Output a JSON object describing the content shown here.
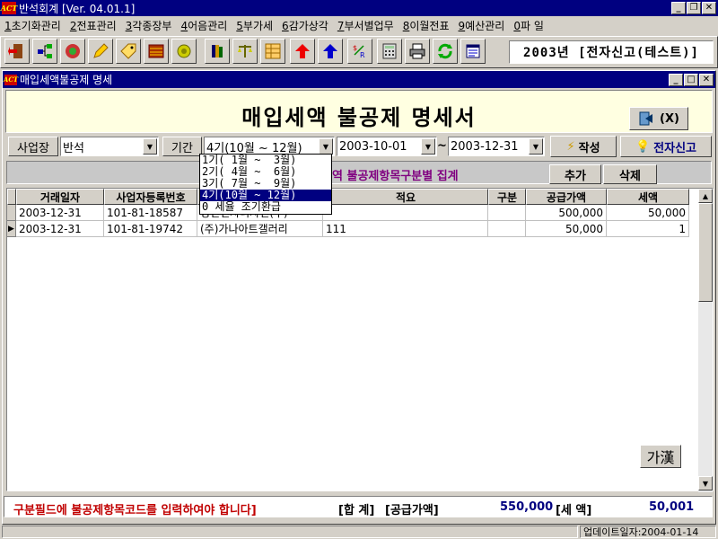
{
  "app": {
    "title": "반석회계 [Ver. 04.01.1]",
    "logo": "ACT"
  },
  "menu": [
    {
      "key": "1",
      "label": "초기화관리"
    },
    {
      "key": "2",
      "label": "전표관리"
    },
    {
      "key": "3",
      "label": "각종장부"
    },
    {
      "key": "4",
      "label": "어음관리"
    },
    {
      "key": "5",
      "label": "부가세"
    },
    {
      "key": "6",
      "label": "감가상각"
    },
    {
      "key": "7",
      "label": "부서별업무"
    },
    {
      "key": "8",
      "label": "이월전표"
    },
    {
      "key": "9",
      "label": "예산관리"
    },
    {
      "key": "0",
      "label": "파 일"
    }
  ],
  "toolbar": {
    "icons": [
      "exit-door-icon",
      "org-tree-icon",
      "globe-icon",
      "pencil-icon",
      "tag-icon",
      "abacus-icon",
      "coin-icon",
      "books-icon",
      "scale-icon",
      "grid-icon",
      "arrow-up-red-icon",
      "arrow-up-blue-icon",
      "currency-icon",
      "calculator-icon",
      "printer-icon",
      "refresh-icon",
      "document-icon"
    ],
    "company": "2003년 [전자신고(테스트)]"
  },
  "child": {
    "title": "매입세액불공제 명세",
    "heading": "매입세액 불공제 명세서",
    "exit_label": "(X)"
  },
  "filters": {
    "business_label": "사업장",
    "business_value": "반석",
    "period_label": "기간",
    "period_value": "4기(10월 ~ 12월)",
    "date_from": "2003-10-01",
    "date_to": "2003-12-31",
    "tilde": "~",
    "create_label": "작성",
    "efile_label": "전자신고"
  },
  "period_options": [
    "1기( 1월 ~  3월)",
    "2기( 4월 ~  6월)",
    "3기( 7월 ~  9월)",
    "4기(10월 ~ 12월)",
    "0 세율 조기환급"
  ],
  "section": {
    "label": "역 불공제항목구분별 집계",
    "add_label": "추가",
    "delete_label": "삭제"
  },
  "grid": {
    "columns": [
      "거래일자",
      "사업자등록번호",
      "",
      "적요",
      "구분",
      "공급가액",
      "세액"
    ],
    "rows": [
      {
        "date": "2003-12-31",
        "regno": "101-81-18587",
        "name": "명진전자디자인(주)",
        "memo": "",
        "type": "",
        "supply": "500,000",
        "tax": "50,000"
      },
      {
        "date": "2003-12-31",
        "regno": "101-81-19742",
        "name": "(주)가나아트갤러리",
        "memo": "111",
        "type": "",
        "supply": "50,000",
        "tax": "1"
      }
    ],
    "hanja_label": "가漢"
  },
  "footer": {
    "warning": "구분필드에 불공제항목코드를 입력하여야 합니다]",
    "total_label": "[합 계]",
    "supply_label": "[공급가액]",
    "supply_total": "550,000",
    "tax_label": "[세   액]",
    "tax_total": "50,001"
  },
  "status": {
    "updated": "업데이트일자:2004-01-14"
  },
  "colors": {
    "title_bar": "#000080",
    "banner": "#ffffe1",
    "warning": "#c00000",
    "totals": "#000080",
    "section_label": "#800080"
  }
}
